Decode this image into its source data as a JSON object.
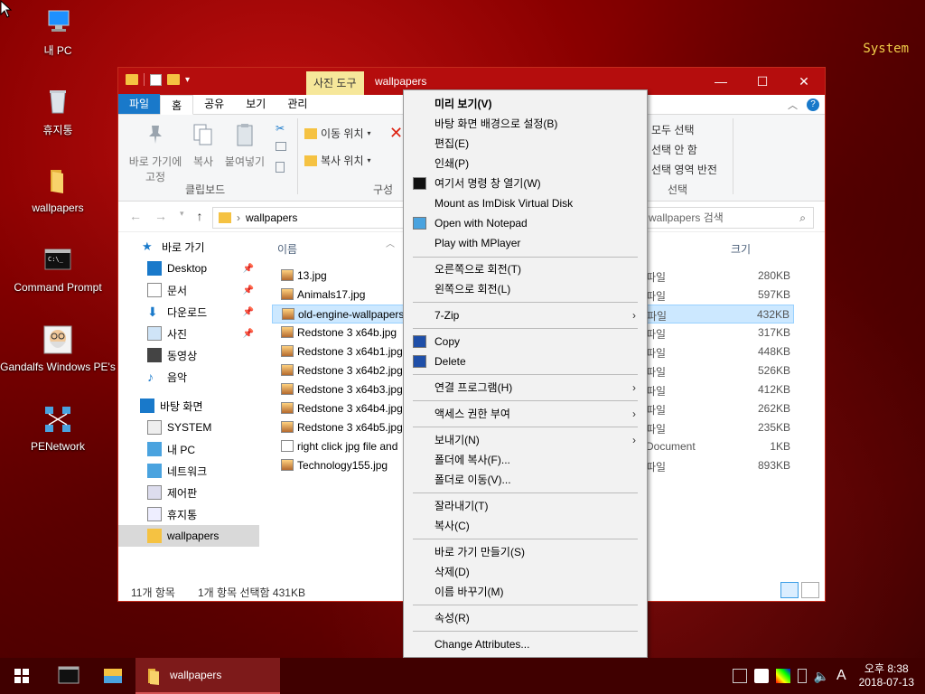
{
  "desktop": {
    "system_label": "System",
    "icons": [
      {
        "label": "내 PC"
      },
      {
        "label": "휴지통"
      },
      {
        "label": "wallpapers"
      },
      {
        "label": "Command Prompt"
      },
      {
        "label": "Gandalfs Windows PE's"
      },
      {
        "label": "PENetwork"
      }
    ]
  },
  "window": {
    "contextual_tab": "사진 도구",
    "title": "wallpapers",
    "controls": {
      "minimize": "—",
      "maximize": "☐",
      "close": "✕"
    },
    "tabs": [
      {
        "label": "파일"
      },
      {
        "label": "홈"
      },
      {
        "label": "공유"
      },
      {
        "label": "보기"
      },
      {
        "label": "관리"
      }
    ],
    "ribbon": {
      "pin_label_1": "바로 가기에",
      "pin_label_2": "고정",
      "copy_label": "복사",
      "paste_label": "붙여넣기",
      "move_to": "이동 위치",
      "copy_to": "복사 위치",
      "clipboard_group": "클립보드",
      "organize_group": "구성",
      "select_all": "모두 선택",
      "select_none": "선택 안 함",
      "invert_selection": "선택 영역 반전",
      "select_group": "선택"
    },
    "address": {
      "path": "wallpapers",
      "search_placeholder": "wallpapers 검색"
    },
    "nav_pane": [
      {
        "label": "바로 가기"
      },
      {
        "label": "Desktop"
      },
      {
        "label": "문서"
      },
      {
        "label": "다운로드"
      },
      {
        "label": "사진"
      },
      {
        "label": "동영상"
      },
      {
        "label": "음악"
      },
      {
        "label": "바탕 화면"
      },
      {
        "label": "SYSTEM"
      },
      {
        "label": "내 PC"
      },
      {
        "label": "네트워크"
      },
      {
        "label": "제어판"
      },
      {
        "label": "휴지통"
      },
      {
        "label": "wallpapers"
      }
    ],
    "columns": {
      "name": "이름",
      "size": "크기"
    },
    "files": [
      {
        "name": "13.jpg",
        "type": "파일",
        "size": "280KB"
      },
      {
        "name": "Animals17.jpg",
        "type": "파일",
        "size": "597KB"
      },
      {
        "name": "old-engine-wallpapers",
        "type": "파일",
        "size": "432KB"
      },
      {
        "name": "Redstone 3 x64b.jpg",
        "type": "파일",
        "size": "317KB"
      },
      {
        "name": "Redstone 3 x64b1.jpg",
        "type": "파일",
        "size": "448KB"
      },
      {
        "name": "Redstone 3 x64b2.jpg",
        "type": "파일",
        "size": "526KB"
      },
      {
        "name": "Redstone 3 x64b3.jpg",
        "type": "파일",
        "size": "412KB"
      },
      {
        "name": "Redstone 3 x64b4.jpg",
        "type": "파일",
        "size": "262KB"
      },
      {
        "name": "Redstone 3 x64b5.jpg",
        "type": "파일",
        "size": "235KB"
      },
      {
        "name": "right click jpg file and",
        "type": "Document",
        "size": "1KB"
      },
      {
        "name": "Technology155.jpg",
        "type": "파일",
        "size": "893KB"
      }
    ],
    "status": {
      "count": "11개 항목",
      "selection": "1개 항목 선택함 431KB"
    }
  },
  "context_menu": {
    "preview": "미리 보기(V)",
    "set_wallpaper": "바탕 화면 배경으로 설정(B)",
    "edit": "편집(E)",
    "print": "인쇄(P)",
    "open_cmd": "여기서 명령 창 열기(W)",
    "imdisk": "Mount as ImDisk Virtual Disk",
    "notepad": "Open with Notepad",
    "mplayer": "Play with MPlayer",
    "rotate_right": "오른쪽으로 회전(T)",
    "rotate_left": "왼쪽으로 회전(L)",
    "sevenzip": "7-Zip",
    "fc_copy": "Copy",
    "fc_delete": "Delete",
    "open_with": "연결 프로그램(H)",
    "give_access": "액세스 권한 부여",
    "send_to": "보내기(N)",
    "copy_to_folder": "폴더에 복사(F)...",
    "move_to_folder": "폴더로 이동(V)...",
    "cut": "잘라내기(T)",
    "copy": "복사(C)",
    "create_shortcut": "바로 가기 만들기(S)",
    "delete": "삭제(D)",
    "rename": "이름 바꾸기(M)",
    "properties": "속성(R)",
    "change_attributes": "Change Attributes..."
  },
  "taskbar": {
    "active_window": "wallpapers",
    "ime": "A",
    "time": "오후 8:38",
    "date": "2018-07-13"
  }
}
